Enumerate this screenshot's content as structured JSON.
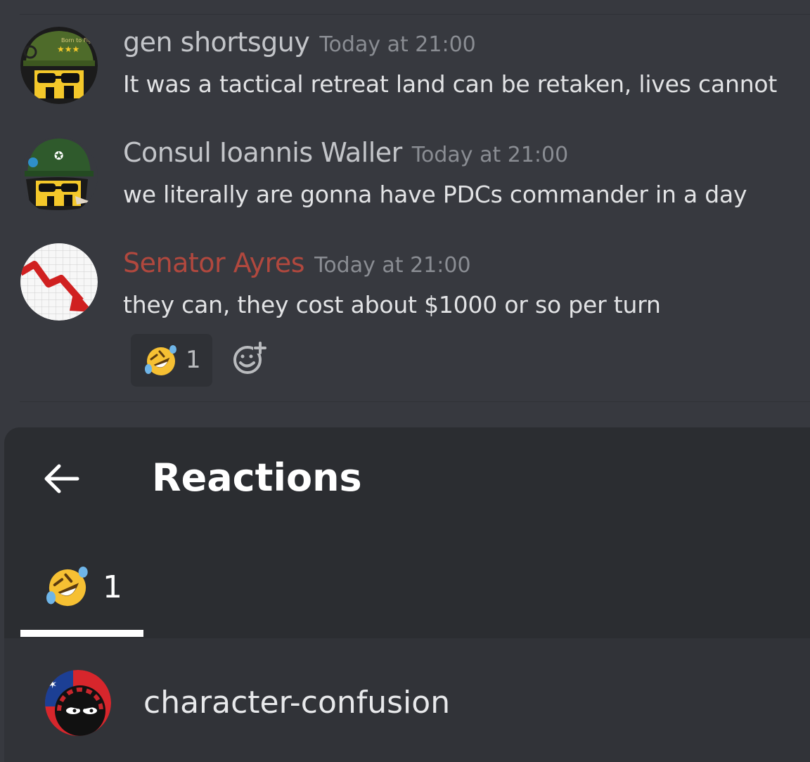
{
  "messages": [
    {
      "author": "gen shortsguy",
      "timestamp": "Today at 21:00",
      "content": "It was a tactical retreat land can be retaken, lives cannot",
      "author_color": "#c3c5c9",
      "avatar_icon": "helmet-avatar-icon",
      "avatar_text": "Born to Fight"
    },
    {
      "author": "Consul Ioannis Waller",
      "timestamp": "Today at 21:00",
      "content": "we literally are gonna have PDCs commander in a day",
      "author_color": "#c3c5c9",
      "avatar_icon": "helmet-avatar-icon"
    },
    {
      "author": "Senator Ayres",
      "timestamp": "Today at 21:00",
      "content": "they can, they cost about $1000 or so per turn",
      "author_color": "#b1483e",
      "avatar_icon": "stock-decline-avatar-icon",
      "reaction": {
        "emoji": "rolling-on-floor-laughing-icon",
        "count": "1"
      }
    }
  ],
  "add_reaction_icon": "add-reaction-icon",
  "reactions_panel": {
    "back_icon": "arrow-left-icon",
    "title": "Reactions",
    "tabs": [
      {
        "emoji": "rolling-on-floor-laughing-icon",
        "count": "1",
        "selected": true
      }
    ],
    "users": [
      {
        "name": "character-confusion",
        "avatar_icon": "countryball-avatar-icon"
      }
    ]
  },
  "colors": {
    "background": "#37393f",
    "sheet": "#2b2d31",
    "list_row": "#313338",
    "reaction_bg": "#2f3136",
    "timestamp": "#8a8d93",
    "accent_underline": "#ffffff"
  }
}
